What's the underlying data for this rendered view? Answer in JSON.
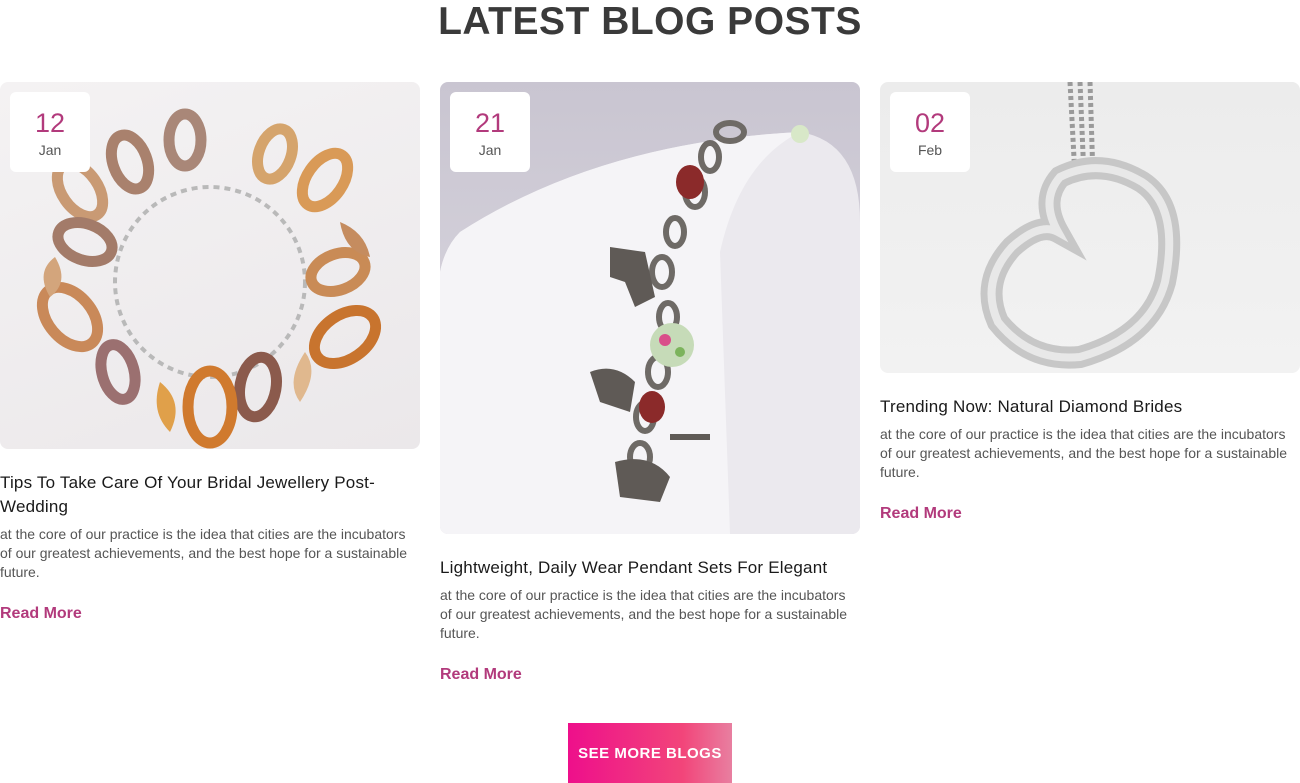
{
  "section": {
    "title": "LATEST BLOG POSTS"
  },
  "posts": [
    {
      "day": "12",
      "month": "Jan",
      "title": "Tips To Take Care Of Your Bridal Jewellery Post-Wedding",
      "excerpt": "at the core of our practice is the idea that cities are the incubators of our greatest achievements, and the best hope for a sustainable future.",
      "read_more": "Read More",
      "image": "wooden-charm-bracelet"
    },
    {
      "day": "21",
      "month": "Jan",
      "title": "Lightweight, Daily Wear Pendant Sets For Elegant",
      "excerpt": "at the core of our practice is the idea that cities are the incubators of our greatest achievements, and the best hope for a sustainable future.",
      "read_more": "Read More",
      "image": "silver-charm-bracelet"
    },
    {
      "day": "02",
      "month": "Feb",
      "title": "Trending Now: Natural Diamond Brides",
      "excerpt": "at the core of our practice is the idea that cities are the incubators of our greatest achievements, and the best hope for a sustainable future.",
      "read_more": "Read More",
      "image": "silver-heart-pendant"
    }
  ],
  "cta": {
    "label": "SEE MORE BLOGS"
  },
  "colors": {
    "accent": "#b23a7c",
    "button_start": "#ee0f8b",
    "button_end": "#e87fa0",
    "heading": "#3a3a3a"
  }
}
